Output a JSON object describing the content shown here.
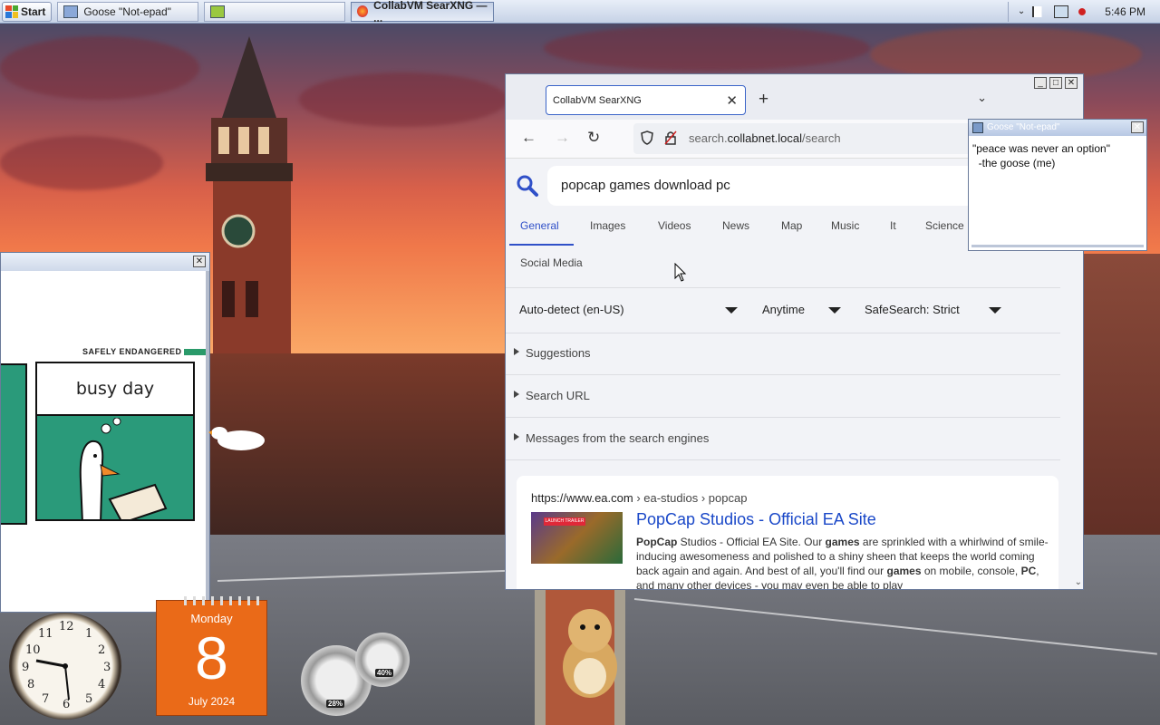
{
  "taskbar": {
    "start_label": "Start",
    "tasks": [
      {
        "label": "Goose \"Not-epad\"",
        "active": false
      },
      {
        "label": "",
        "active": false
      },
      {
        "label": "CollabVM SearXNG — ...",
        "active": true
      }
    ],
    "clock": "5:46 PM"
  },
  "comic": {
    "brand": "SAFELY ENDANGERED",
    "caption": "busy day"
  },
  "browser": {
    "tab_title": "CollabVM SearXNG",
    "url_host": "search.",
    "url_domain": "collabnet.local",
    "url_path": "/search",
    "query": "popcap games download pc",
    "categories": [
      "General",
      "Images",
      "Videos",
      "News",
      "Map",
      "Music",
      "It",
      "Science"
    ],
    "categories_row2": "Social Media",
    "filters": {
      "language": "Auto-detect (en-US)",
      "time": "Anytime",
      "safesearch": "SafeSearch: Strict"
    },
    "sections": [
      "Suggestions",
      "Search URL",
      "Messages from the search engines"
    ],
    "result": {
      "url": "https://www.ea.com",
      "breadcrumb": " › ea-studios › popcap",
      "thumb_tag": "LAUNCH TRAILER",
      "title": "PopCap Studios - Official EA Site",
      "snippet_html_parts": [
        {
          "b": "PopCap"
        },
        {
          "t": " Studios - Official EA Site. Our "
        },
        {
          "b": "games"
        },
        {
          "t": " are sprinkled with a whirlwind of smile-inducing awesomeness and polished to a shiny sheen that keeps the world coming back again and again. And best of all, you'll find our "
        },
        {
          "b": "games"
        },
        {
          "t": " on mobile, console, "
        },
        {
          "b": "PC"
        },
        {
          "t": ", and many other devices - you may even be able to play"
        }
      ]
    }
  },
  "notepad": {
    "title": "Goose \"Not-epad\"",
    "text": "\"peace was never an option\"\n  -the goose (me)"
  },
  "gadgets": {
    "calendar_day": "Monday",
    "calendar_date": "8",
    "calendar_month": "July 2024",
    "cpu_percent": "28%",
    "mem_percent": "40%",
    "clock_numbers": [
      "12",
      "1",
      "2",
      "3",
      "4",
      "5",
      "6",
      "7",
      "8",
      "9",
      "10",
      "11"
    ]
  },
  "colors": {
    "accent": "#3050c8",
    "link": "#1a48c8",
    "calendar": "#ea6a18",
    "comic_green": "#2a9a7a"
  },
  "icons": [
    "windows-flag-icon",
    "notepad-icon",
    "firefox-icon",
    "back-icon",
    "forward-icon",
    "reload-icon",
    "shield-icon",
    "lock-icon",
    "reader-icon",
    "star-icon",
    "search-icon",
    "close-icon",
    "plus-icon",
    "chevron-down-icon",
    "flag-icon",
    "network-icon",
    "volume-muted-icon"
  ]
}
